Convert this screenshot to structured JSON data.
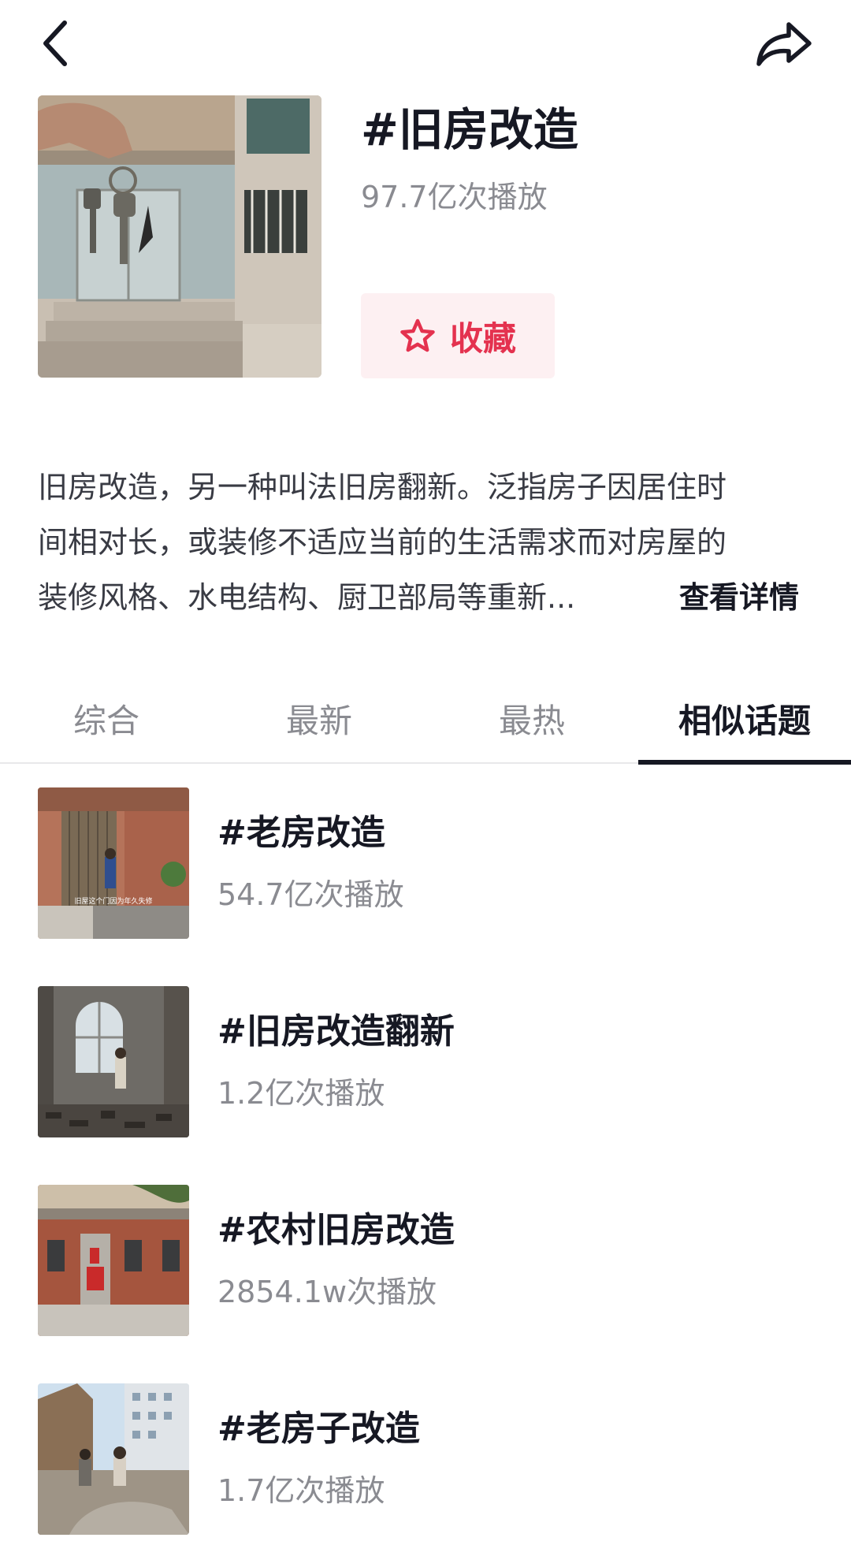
{
  "header": {
    "back_icon": "chevron-left-icon",
    "share_icon": "share-arrow-icon"
  },
  "topic": {
    "title": "#旧房改造",
    "plays": "97.7亿次播放",
    "collect_label": "收藏",
    "collect_icon": "star-outline-icon",
    "accent_color": "#e4324f",
    "description_lines": [
      "旧房改造，另一种叫法旧房翻新。泛指房子因居住时",
      "间相对长，或装修不适应当前的生活需求而对房屋的",
      "装修风格、水电结构、厨卫部局等重新..."
    ],
    "more_label": "查看详情"
  },
  "tabs": [
    {
      "label": "综合",
      "active": false
    },
    {
      "label": "最新",
      "active": false
    },
    {
      "label": "最热",
      "active": false
    },
    {
      "label": "相似话题",
      "active": true
    }
  ],
  "similar_topics": [
    {
      "name": "#老房改造",
      "plays": "54.7亿次播放",
      "thumb_caption": "旧屋这个门因为年久失修"
    },
    {
      "name": "#旧房改造翻新",
      "plays": "1.2亿次播放"
    },
    {
      "name": "#农村旧房改造",
      "plays": "2854.1w次播放"
    },
    {
      "name": "#老房子改造",
      "plays": "1.7亿次播放"
    }
  ]
}
